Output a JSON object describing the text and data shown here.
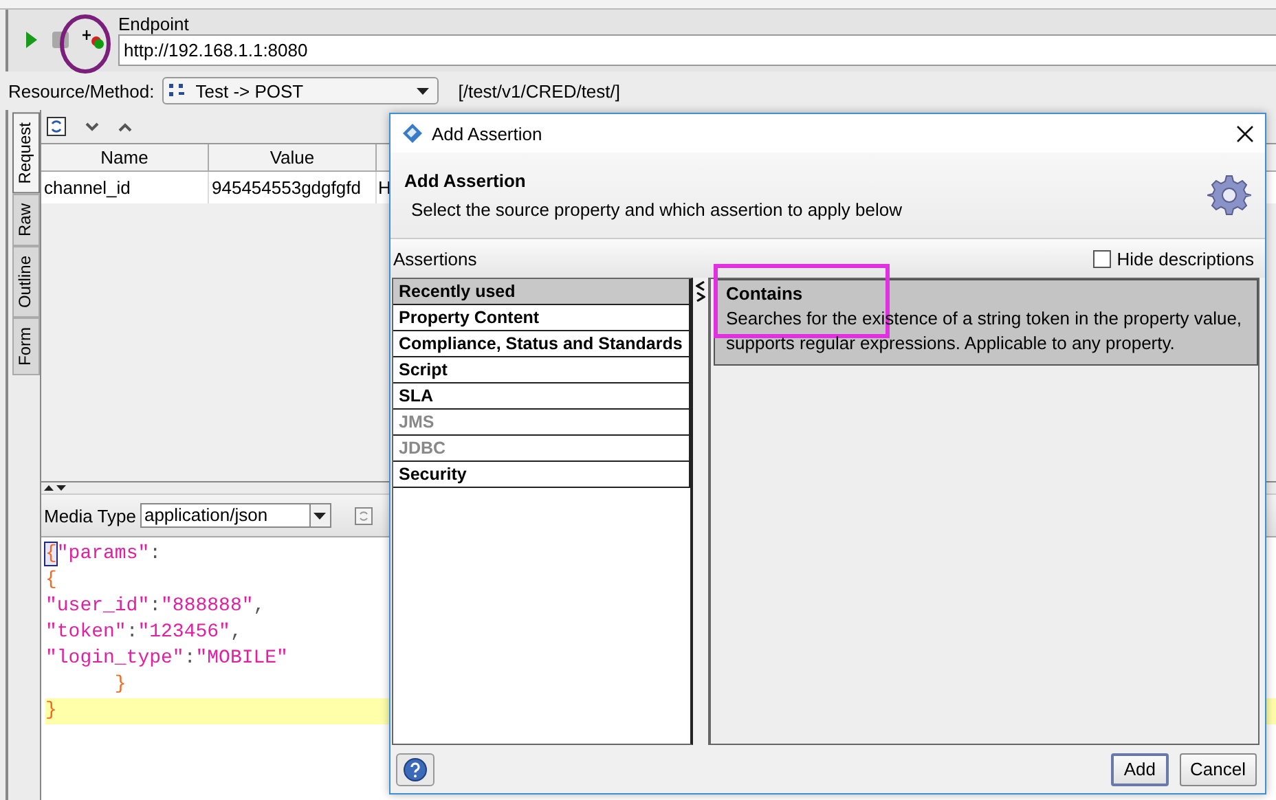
{
  "toolbar": {
    "endpoint_label": "Endpoint",
    "endpoint": "http://192.168.1.1:8080"
  },
  "resource": {
    "label": "Resource/Method:",
    "value": "Test -> POST",
    "path": "[/test/v1/CRED/test/]"
  },
  "side_tabs": [
    {
      "label": "Request",
      "selected": true
    },
    {
      "label": "Raw",
      "selected": false
    },
    {
      "label": "Outline",
      "selected": false
    },
    {
      "label": "Form",
      "selected": false
    }
  ],
  "params_table": {
    "columns": [
      "Name",
      "Value"
    ],
    "rows": [
      [
        "channel_id",
        "945454553gdgfgfd",
        "H"
      ]
    ]
  },
  "media_type": {
    "label": "Media Type",
    "value": "application/json"
  },
  "editor_lines": [
    {
      "current": false,
      "tokens": [
        {
          "text": "{",
          "kind": "brace",
          "matched": true
        },
        {
          "text": "\"params\"",
          "kind": "string"
        },
        {
          "text": ":",
          "kind": "punct"
        }
      ]
    },
    {
      "current": false,
      "tokens": [
        {
          "text": "{",
          "kind": "brace"
        }
      ]
    },
    {
      "current": false,
      "tokens": [
        {
          "text": "\"user_id\"",
          "kind": "string"
        },
        {
          "text": ":",
          "kind": "punct"
        },
        {
          "text": "\"888888\"",
          "kind": "string"
        },
        {
          "text": ",",
          "kind": "punct"
        }
      ]
    },
    {
      "current": false,
      "tokens": [
        {
          "text": "\"token\"",
          "kind": "string"
        },
        {
          "text": ":",
          "kind": "punct"
        },
        {
          "text": "\"123456\"",
          "kind": "string"
        },
        {
          "text": ",",
          "kind": "punct"
        }
      ]
    },
    {
      "current": false,
      "tokens": [
        {
          "text": "\"login_type\"",
          "kind": "string"
        },
        {
          "text": ":",
          "kind": "punct"
        },
        {
          "text": "\"MOBILE\"",
          "kind": "string"
        }
      ]
    },
    {
      "current": false,
      "tokens": [
        {
          "text": "      }",
          "kind": "brace"
        }
      ]
    },
    {
      "current": true,
      "tokens": [
        {
          "text": "}",
          "kind": "brace"
        }
      ]
    }
  ],
  "dialog": {
    "title": "Add Assertion",
    "heading": "Add Assertion",
    "subtitle": "Select the source property and which assertion to apply below",
    "section_label": "Assertions",
    "hide_descriptions": {
      "label": "Hide descriptions",
      "checked": false
    },
    "categories": [
      {
        "label": "Recently used",
        "selected": true,
        "disabled": false
      },
      {
        "label": "Property Content",
        "selected": false,
        "disabled": false
      },
      {
        "label": "Compliance, Status and Standards",
        "selected": false,
        "disabled": false
      },
      {
        "label": "Script",
        "selected": false,
        "disabled": false
      },
      {
        "label": "SLA",
        "selected": false,
        "disabled": false
      },
      {
        "label": "JMS",
        "selected": false,
        "disabled": true
      },
      {
        "label": "JDBC",
        "selected": false,
        "disabled": true
      },
      {
        "label": "Security",
        "selected": false,
        "disabled": false
      }
    ],
    "assertions": [
      {
        "name": "Contains",
        "description": "Searches for the existence of a string token in the property value, supports regular expressions. Applicable to any property.",
        "selected": true
      }
    ],
    "buttons": [
      {
        "label": "Add",
        "default": true
      },
      {
        "label": "Cancel",
        "default": false
      }
    ]
  }
}
